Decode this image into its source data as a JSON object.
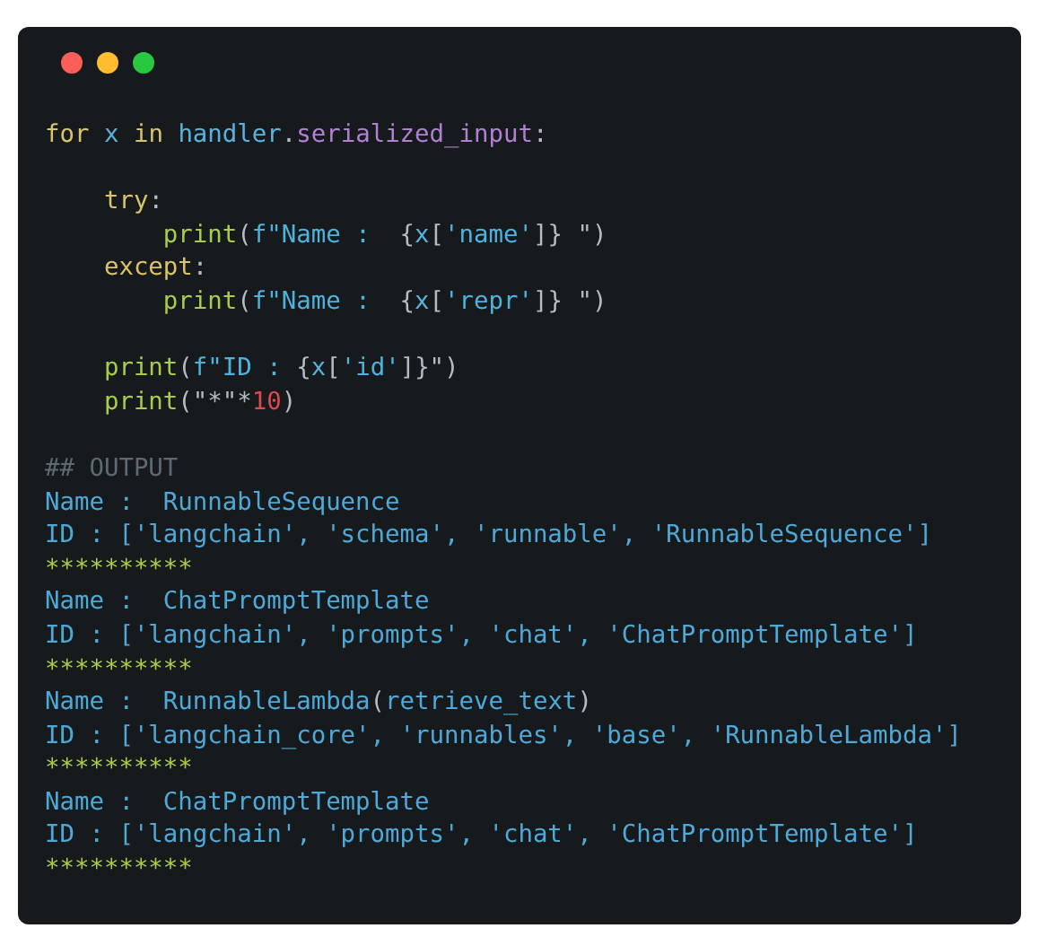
{
  "window": {
    "controls": [
      {
        "color": "#ff5f57"
      },
      {
        "color": "#febc2e"
      },
      {
        "color": "#28c840"
      }
    ]
  },
  "code": {
    "blocks": [
      [
        [
          {
            "text": "for ",
            "kind": "kw"
          },
          {
            "text": "x ",
            "kind": "var"
          },
          {
            "text": "in ",
            "kind": "kw"
          },
          {
            "text": "handler",
            "kind": "var"
          },
          {
            "text": ".",
            "kind": "punct"
          },
          {
            "text": "serialized_input",
            "kind": "attr"
          },
          {
            "text": ":",
            "kind": "punct"
          }
        ]
      ],
      [
        [
          {
            "text": "    try",
            "kind": "kw"
          },
          {
            "text": ":",
            "kind": "punct"
          }
        ],
        [
          {
            "text": "        print",
            "kind": "fn"
          },
          {
            "text": "(",
            "kind": "punct"
          },
          {
            "text": "f\"Name :  ",
            "kind": "str"
          },
          {
            "text": "{",
            "kind": "punct"
          },
          {
            "text": "x",
            "kind": "var"
          },
          {
            "text": "[",
            "kind": "punct"
          },
          {
            "text": "'name'",
            "kind": "str"
          },
          {
            "text": "]} \")",
            "kind": "punct"
          }
        ],
        [
          {
            "text": "    except",
            "kind": "kw"
          },
          {
            "text": ":",
            "kind": "punct"
          }
        ],
        [
          {
            "text": "        print",
            "kind": "fn"
          },
          {
            "text": "(",
            "kind": "punct"
          },
          {
            "text": "f\"Name :  ",
            "kind": "str"
          },
          {
            "text": "{",
            "kind": "punct"
          },
          {
            "text": "x",
            "kind": "var"
          },
          {
            "text": "[",
            "kind": "punct"
          },
          {
            "text": "'repr'",
            "kind": "str"
          },
          {
            "text": "]} \")",
            "kind": "punct"
          }
        ]
      ],
      [
        [
          {
            "text": "    print",
            "kind": "fn"
          },
          {
            "text": "(",
            "kind": "punct"
          },
          {
            "text": "f\"ID : ",
            "kind": "str"
          },
          {
            "text": "{",
            "kind": "punct"
          },
          {
            "text": "x",
            "kind": "var"
          },
          {
            "text": "[",
            "kind": "punct"
          },
          {
            "text": "'id'",
            "kind": "str"
          },
          {
            "text": "]}\")",
            "kind": "punct"
          }
        ],
        [
          {
            "text": "    print",
            "kind": "fn"
          },
          {
            "text": "(\"*\"*",
            "kind": "punct"
          },
          {
            "text": "10",
            "kind": "num"
          },
          {
            "text": ")",
            "kind": "punct"
          }
        ]
      ],
      [
        [
          {
            "text": "## OUTPUT",
            "kind": "comment"
          }
        ],
        [
          {
            "text": "Name :  RunnableSequence",
            "kind": "out"
          }
        ],
        [
          {
            "text": "ID : ['langchain', 'schema', 'runnable', 'RunnableSequence']",
            "kind": "out"
          }
        ],
        [
          {
            "text": "**********",
            "kind": "stars"
          }
        ],
        [
          {
            "text": "Name :  ChatPromptTemplate",
            "kind": "out"
          }
        ],
        [
          {
            "text": "ID : ['langchain', 'prompts', 'chat', 'ChatPromptTemplate']",
            "kind": "out"
          }
        ],
        [
          {
            "text": "**********",
            "kind": "stars"
          }
        ],
        [
          {
            "text": "Name :  RunnableLambda",
            "kind": "out"
          },
          {
            "text": "(",
            "kind": "punct"
          },
          {
            "text": "retrieve_text",
            "kind": "out"
          },
          {
            "text": ")",
            "kind": "punct"
          }
        ],
        [
          {
            "text": "ID : ['langchain_core', 'runnables', 'base', 'RunnableLambda']",
            "kind": "out"
          }
        ],
        [
          {
            "text": "**********",
            "kind": "stars"
          }
        ],
        [
          {
            "text": "Name :  ChatPromptTemplate",
            "kind": "out"
          }
        ],
        [
          {
            "text": "ID : ['langchain', 'prompts', 'chat', 'ChatPromptTemplate']",
            "kind": "out"
          }
        ],
        [
          {
            "text": "**********",
            "kind": "stars"
          }
        ]
      ]
    ]
  }
}
